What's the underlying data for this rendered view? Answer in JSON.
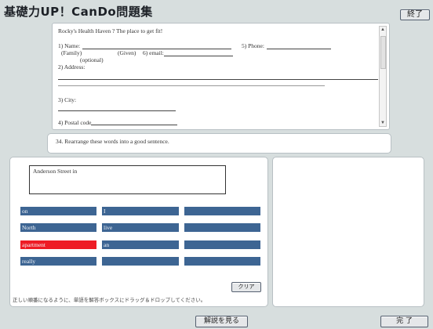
{
  "header": {
    "title": "基礎力UP！CanDo問題集",
    "exit_label": "終了"
  },
  "document": {
    "heading": "Rocky's Health Haven ? The place to get fit!",
    "name_label": "1) Name:",
    "phone_label": "5) Phone:",
    "family_label": "(Family)",
    "given_label": "(Given)",
    "email_label": "6) email:",
    "optional_label": "(optional)",
    "address_label": "2) Address:",
    "city_label": "3) City:",
    "postal_label": "4) Postal code"
  },
  "question": {
    "text": "34.   Rearrange these words into a good sentence."
  },
  "answer_box": {
    "value": "Anderson Street in"
  },
  "tiles": [
    {
      "label": "on",
      "selected": false
    },
    {
      "label": "I",
      "selected": false
    },
    {
      "label": "",
      "selected": false
    },
    {
      "label": "North",
      "selected": false
    },
    {
      "label": "live",
      "selected": false
    },
    {
      "label": "",
      "selected": false
    },
    {
      "label": "apartment",
      "selected": true
    },
    {
      "label": "an",
      "selected": false
    },
    {
      "label": "",
      "selected": false
    },
    {
      "label": "really",
      "selected": false
    },
    {
      "label": "",
      "selected": false
    },
    {
      "label": "",
      "selected": false
    }
  ],
  "clear_label": "クリア",
  "instruction": "正しい順番になるように、単語を解答ボックスにドラッグ＆ドロップしてください。",
  "footer": {
    "explanation_label": "解説を見る",
    "done_label": "完 了"
  },
  "colors": {
    "tile": "#3d6593",
    "tile_selected": "#ee1c25",
    "background": "#d7dede"
  }
}
